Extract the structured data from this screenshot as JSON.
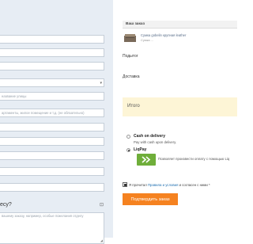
{
  "form": {
    "street_placeholder": "название улицы",
    "apartment_placeholder": "артаменты, жилое помещение и т.д. (не обязательно)",
    "ask_question": "есу?",
    "comment_placeholder": "вашему заказу, например, особые пожелания отделу"
  },
  "order": {
    "header": "Ваш заказ",
    "product_name": "Сумка gobelin крупная leather",
    "product_color": "Сумка ...",
    "subtotal_label": "Подытог",
    "shipping_label": "Доставка",
    "total_label": "Итого"
  },
  "payment": {
    "cod_label": "Cash on delivery",
    "cod_desc": "Pay with cash upon delivery.",
    "liqpay_label": "LiqPay",
    "liqpay_desc": "Позволяет произвести оплату с помощью Liq"
  },
  "terms": {
    "prefix": "Я прочитал",
    "link": "Правила и условия",
    "suffix": "и согласен с ними *"
  },
  "confirm_button": "Подтвердить заказ",
  "colors": {
    "accent_button": "#f58220",
    "liqpay_green": "#6fae3a",
    "total_bg": "#fdf5d6",
    "form_panel_bg": "#e7edf4"
  }
}
